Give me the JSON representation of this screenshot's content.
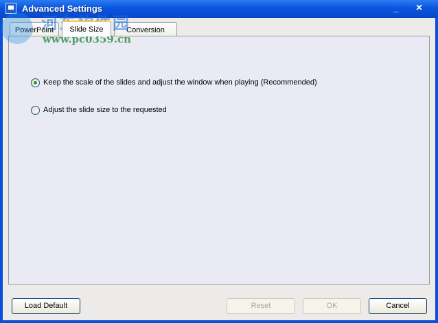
{
  "window": {
    "title": "Advanced Settings",
    "minimize": "_",
    "close": "×"
  },
  "watermark": {
    "cn": "河东软件园",
    "url": "www.pc0359.cn"
  },
  "tabs": [
    {
      "label": "PowerPoint",
      "selected": false
    },
    {
      "label": "Slide Size",
      "selected": true
    },
    {
      "label": "Conversion",
      "selected": false
    }
  ],
  "options": [
    {
      "label": "Keep the scale of the slides and adjust the window when playing (Recommended)",
      "checked": true
    },
    {
      "label": "Adjust the slide size to the requested",
      "checked": false
    }
  ],
  "buttons": {
    "load_default": "Load Default",
    "reset": "Reset",
    "ok": "OK",
    "cancel": "Cancel"
  },
  "colors": {
    "titlebar": "#0b55e0",
    "panel": "#eaeaf4",
    "radio_dot": "#21a121"
  }
}
